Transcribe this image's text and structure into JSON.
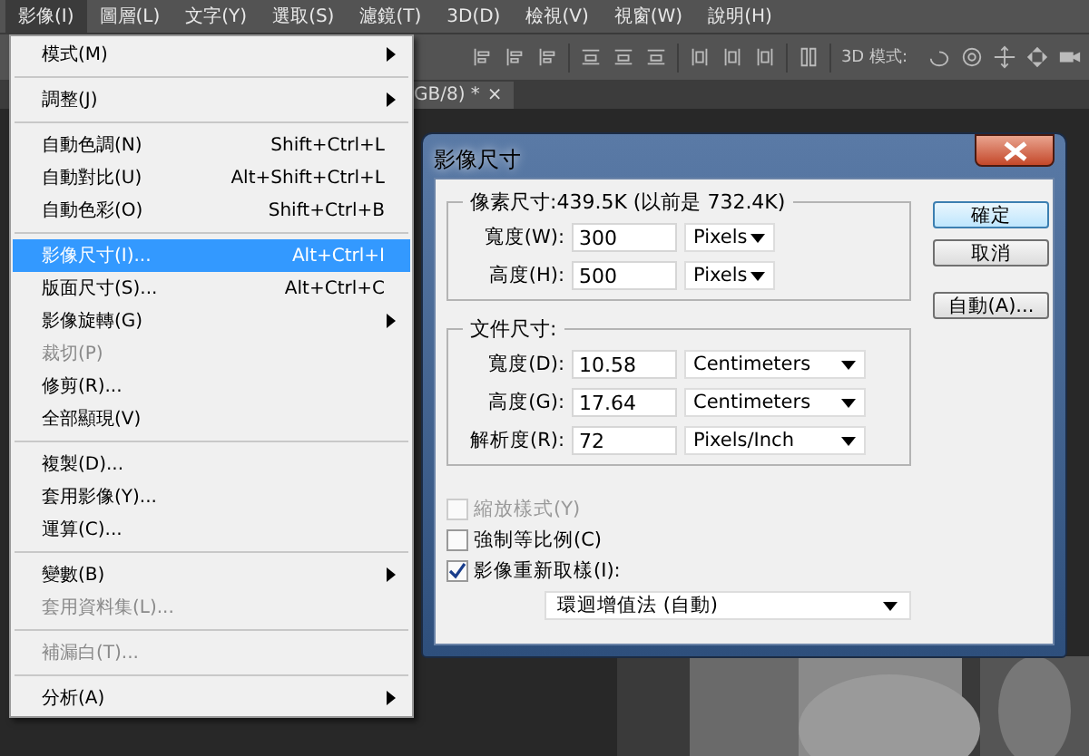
{
  "menubar": [
    {
      "label": "影像(I)",
      "selected": true
    },
    {
      "label": "圖層(L)",
      "selected": false
    },
    {
      "label": "文字(Y)",
      "selected": false
    },
    {
      "label": "選取(S)",
      "selected": false
    },
    {
      "label": "濾鏡(T)",
      "selected": false
    },
    {
      "label": "3D(D)",
      "selected": false
    },
    {
      "label": "檢視(V)",
      "selected": false
    },
    {
      "label": "視窗(W)",
      "selected": false
    },
    {
      "label": "說明(H)",
      "selected": false
    }
  ],
  "options_bar": {
    "mode_label": "3D 模式:"
  },
  "document_tab": {
    "title": "GB/8) *",
    "close": "×"
  },
  "menu": [
    {
      "kind": "item",
      "label": "模式(M)",
      "submenu": true,
      "disabled": false,
      "selected": false
    },
    {
      "kind": "separator"
    },
    {
      "kind": "item",
      "label": "調整(J)",
      "submenu": true,
      "disabled": false,
      "selected": false
    },
    {
      "kind": "separator"
    },
    {
      "kind": "item",
      "label": "自動色調(N)",
      "shortcut": "Shift+Ctrl+L",
      "submenu": false,
      "disabled": false,
      "selected": false
    },
    {
      "kind": "item",
      "label": "自動對比(U)",
      "shortcut": "Alt+Shift+Ctrl+L",
      "submenu": false,
      "disabled": false,
      "selected": false
    },
    {
      "kind": "item",
      "label": "自動色彩(O)",
      "shortcut": "Shift+Ctrl+B",
      "submenu": false,
      "disabled": false,
      "selected": false
    },
    {
      "kind": "separator"
    },
    {
      "kind": "item",
      "label": "影像尺寸(I)...",
      "shortcut": "Alt+Ctrl+I",
      "submenu": false,
      "disabled": false,
      "selected": true
    },
    {
      "kind": "item",
      "label": "版面尺寸(S)...",
      "shortcut": "Alt+Ctrl+C",
      "submenu": false,
      "disabled": false,
      "selected": false
    },
    {
      "kind": "item",
      "label": "影像旋轉(G)",
      "submenu": true,
      "disabled": false,
      "selected": false
    },
    {
      "kind": "item",
      "label": "裁切(P)",
      "submenu": false,
      "disabled": true,
      "selected": false
    },
    {
      "kind": "item",
      "label": "修剪(R)...",
      "submenu": false,
      "disabled": false,
      "selected": false
    },
    {
      "kind": "item",
      "label": "全部顯現(V)",
      "submenu": false,
      "disabled": false,
      "selected": false
    },
    {
      "kind": "separator"
    },
    {
      "kind": "item",
      "label": "複製(D)...",
      "submenu": false,
      "disabled": false,
      "selected": false
    },
    {
      "kind": "item",
      "label": "套用影像(Y)...",
      "submenu": false,
      "disabled": false,
      "selected": false
    },
    {
      "kind": "item",
      "label": "運算(C)...",
      "submenu": false,
      "disabled": false,
      "selected": false
    },
    {
      "kind": "separator"
    },
    {
      "kind": "item",
      "label": "變數(B)",
      "submenu": true,
      "disabled": false,
      "selected": false
    },
    {
      "kind": "item",
      "label": "套用資料集(L)...",
      "submenu": false,
      "disabled": true,
      "selected": false
    },
    {
      "kind": "separator"
    },
    {
      "kind": "item",
      "label": "補漏白(T)...",
      "submenu": false,
      "disabled": true,
      "selected": false
    },
    {
      "kind": "separator"
    },
    {
      "kind": "item",
      "label": "分析(A)",
      "submenu": true,
      "disabled": false,
      "selected": false
    }
  ],
  "dialog": {
    "title": "影像尺寸",
    "pixel_group": {
      "title": "像素尺寸:439.5K (以前是 732.4K)",
      "fields": [
        {
          "label": "寬度(W):",
          "value": "300",
          "unit": "Pixels"
        },
        {
          "label": "高度(H):",
          "value": "500",
          "unit": "Pixels"
        }
      ]
    },
    "document_group": {
      "title": "文件尺寸:",
      "fields": [
        {
          "label": "寬度(D):",
          "value": "10.58",
          "unit": "Centimeters"
        },
        {
          "label": "高度(G):",
          "value": "17.64",
          "unit": "Centimeters"
        },
        {
          "label": "解析度(R):",
          "value": "72",
          "unit": "Pixels/Inch"
        }
      ]
    },
    "checkboxes": [
      {
        "label": "縮放樣式(Y)",
        "checked": false,
        "disabled": true
      },
      {
        "label": "強制等比例(C)",
        "checked": false,
        "disabled": false
      },
      {
        "label": "影像重新取樣(I):",
        "checked": true,
        "disabled": false
      }
    ],
    "resample": "環迴增值法 (自動)",
    "buttons": [
      {
        "label": "確定",
        "default": true
      },
      {
        "label": "取消",
        "default": false
      },
      {
        "label": "自動(A)...",
        "default": false
      }
    ]
  }
}
